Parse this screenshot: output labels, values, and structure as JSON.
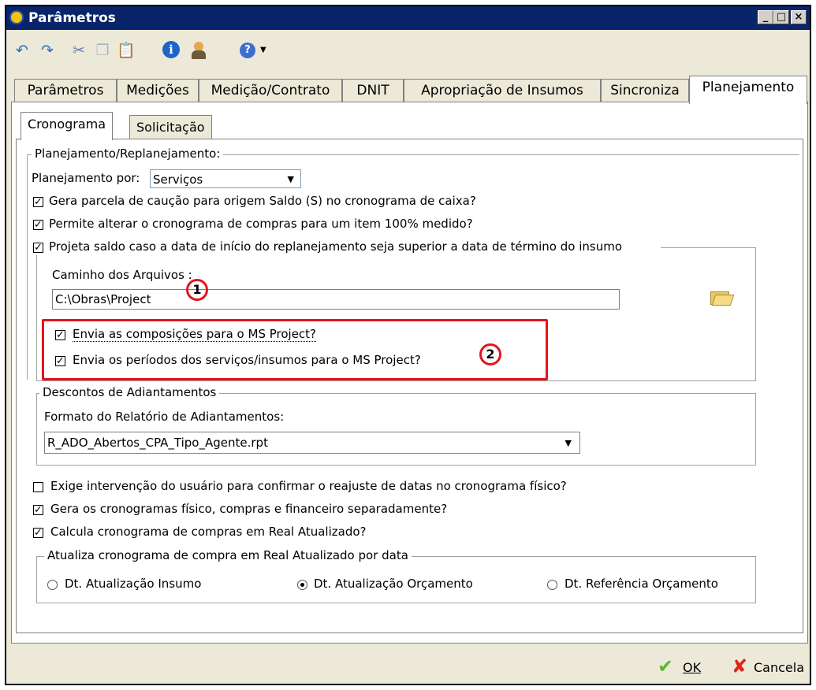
{
  "window": {
    "title": "Parâmetros",
    "min_label": "_",
    "max_label": "□",
    "close_label": "×"
  },
  "toolbar": {
    "icons": [
      "undo-icon",
      "redo-icon",
      "cut-icon",
      "copy-icon",
      "paste-icon",
      "info-icon",
      "user-icon",
      "help-icon"
    ]
  },
  "tabs": [
    "Parâmetros",
    "Medições",
    "Medição/Contrato",
    "DNIT",
    "Apropriação de Insumos",
    "Sincroniza",
    "Planejamento"
  ],
  "active_tab": "Planejamento",
  "subtabs": [
    "Cronograma",
    "Solicitação"
  ],
  "active_subtab": "Cronograma",
  "planejamento": {
    "group_title": "Planejamento/Replanejamento:",
    "plan_por_label": "Planejamento por:",
    "plan_por_value": "Serviços",
    "cb_caucao": "Gera parcela de caução para origem Saldo (S) no cronograma de caixa?",
    "cb_alterar": "Permite alterar o cronograma de compras para um item 100% medido?",
    "cb_projeta": "Projeta saldo caso a data de início do replanejamento seja superior a data de término do insumo",
    "caminho_label": "Caminho dos Arquivos :",
    "caminho_value": "C:\\Obras\\Project",
    "cb_composicoes": "Envia as composições para  o MS Project?",
    "cb_periodos": "Envia os períodos dos serviços/insumos para o MS Project?",
    "marker1": "1",
    "marker2": "2"
  },
  "descontos": {
    "group_title": "Descontos de Adiantamentos",
    "formato_label": "Formato do Relatório de Adiantamentos:",
    "formato_value": "R_ADO_Abertos_CPA_Tipo_Agente.rpt"
  },
  "options": {
    "cb_exige": "Exige intervenção do usuário para confirmar o reajuste de datas no cronograma físico?",
    "cb_gera": "Gera os cronogramas físico, compras e financeiro separadamente?",
    "cb_calcula": "Calcula cronograma de compras em Real Atualizado?"
  },
  "atualiza": {
    "group_title": "Atualiza cronograma de compra em Real Atualizado por data",
    "radio1": "Dt. Atualização Insumo",
    "radio2": "Dt. Atualização Orçamento",
    "radio3": "Dt. Referência Orçamento",
    "selected": "Dt. Atualização Orçamento"
  },
  "checked": {
    "caucao": true,
    "alterar": true,
    "projeta": true,
    "composicoes": true,
    "periodos": true,
    "exige": false,
    "gera": true,
    "calcula": true
  },
  "buttons": {
    "ok": "OK",
    "cancel": "Cancela"
  },
  "colors": {
    "titlebar": "#0a246a",
    "highlight": "#e5141a",
    "ok_icon": "#5fb42e",
    "cancel_icon": "#e0241b"
  }
}
